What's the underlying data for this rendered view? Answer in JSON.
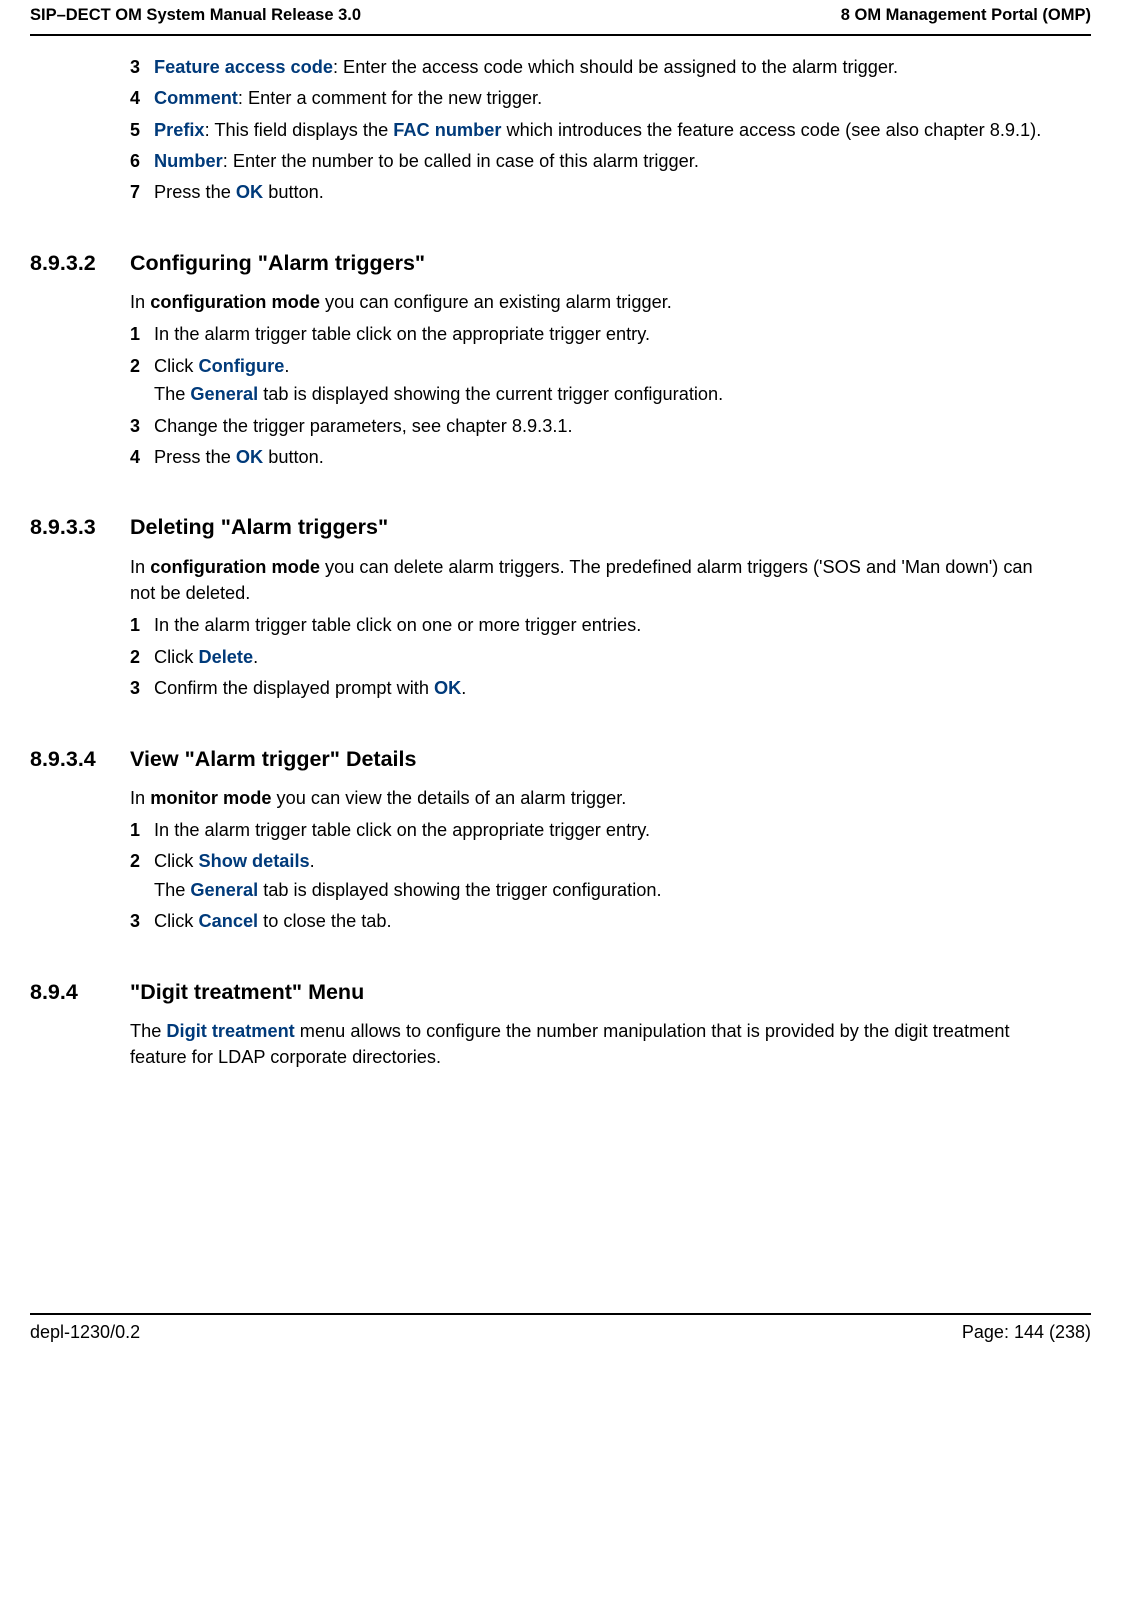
{
  "header": {
    "left": "SIP–DECT OM System Manual Release 3.0",
    "right": "8 OM Management Portal (OMP)"
  },
  "footer": {
    "left": "depl-1230/0.2",
    "right": "Page: 144 (238)"
  },
  "terms": {
    "feature_access_code": "Feature access code",
    "comment": "Comment",
    "prefix": "Prefix",
    "fac_number": "FAC number",
    "number": "Number",
    "ok": "OK",
    "configure": "Configure",
    "general": "General",
    "delete": "Delete",
    "show_details": "Show details",
    "cancel": "Cancel",
    "digit_treatment": "Digit treatment",
    "config_mode": "configuration mode",
    "monitor_mode": "monitor mode"
  },
  "top_list": {
    "n3": "3",
    "n4": "4",
    "n5": "5",
    "n6": "6",
    "n7": "7",
    "t3_before": "",
    "t3_after": ": Enter the access code which should be assigned to the alarm trigger.",
    "t4_after": ": Enter a comment for the new trigger.",
    "t5_mid1": ": This field displays the ",
    "t5_mid2": " which introduces the feature access code (see also chapter 8.9.1).",
    "t6_after": ": Enter the number to be called in case of this alarm trigger.",
    "t7_before": "Press the ",
    "t7_after": " button."
  },
  "sec2": {
    "num": "8.9.3.2",
    "title": "Configuring \"Alarm triggers\"",
    "intro_before": "In ",
    "intro_after": " you can configure an existing alarm trigger.",
    "n1": "1",
    "t1": "In the alarm trigger table click on the appropriate trigger entry.",
    "n2": "2",
    "t2_before": "Click ",
    "t2_after": ".",
    "t2_sub_before": "The ",
    "t2_sub_after": " tab is displayed showing the current trigger configuration.",
    "n3": "3",
    "t3": "Change the trigger parameters, see chapter 8.9.3.1.",
    "n4": "4",
    "t4_before": "Press the ",
    "t4_after": " button."
  },
  "sec3": {
    "num": "8.9.3.3",
    "title": "Deleting \"Alarm triggers\"",
    "intro_before": "In ",
    "intro_after": " you can delete alarm triggers. The predefined alarm triggers ('SOS and 'Man down') can not be deleted.",
    "n1": "1",
    "t1": "In the alarm trigger table click on one or more trigger entries.",
    "n2": "2",
    "t2_before": "Click ",
    "t2_after": ".",
    "n3": "3",
    "t3_before": "Confirm the displayed prompt with ",
    "t3_after": "."
  },
  "sec4": {
    "num": "8.9.3.4",
    "title": "View \"Alarm trigger\" Details",
    "intro_before": "In ",
    "intro_after": " you can view the details of an alarm trigger.",
    "n1": "1",
    "t1": "In the alarm trigger table click on the appropriate trigger entry.",
    "n2": "2",
    "t2_before": "Click ",
    "t2_after": ".",
    "t2_sub_before": "The ",
    "t2_sub_after": " tab is displayed showing the trigger configuration.",
    "n3": "3",
    "t3_before": "Click ",
    "t3_after": " to close the tab."
  },
  "sec5": {
    "num": "8.9.4",
    "title": "\"Digit treatment\" Menu",
    "p_before": "The ",
    "p_after": " menu allows to configure the number manipulation that is provided by the digit treatment feature for LDAP corporate directories."
  }
}
